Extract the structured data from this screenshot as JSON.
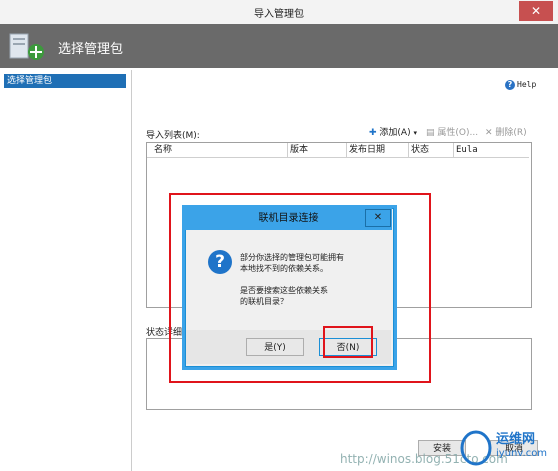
{
  "window": {
    "title": "导入管理包",
    "close_glyph": "✕"
  },
  "header": {
    "title": "选择管理包"
  },
  "sidebar": {
    "items": [
      {
        "label": "选择管理包"
      }
    ]
  },
  "help": {
    "label": "Help"
  },
  "import_list": {
    "label": "导入列表(M):",
    "toolbar": {
      "add": "添加(A)",
      "properties": "属性(O)...",
      "delete": "删除(R)"
    },
    "columns": [
      "名称",
      "版本",
      "发布日期",
      "状态",
      "Eula"
    ]
  },
  "status_details": {
    "label": "状态详细信息"
  },
  "dialog": {
    "title": "联机目录连接",
    "message_line1": "部分你选择的管理包可能拥有",
    "message_line2": "本地找不到的依赖关系。",
    "message_line3": "是否要搜索这些依赖关系",
    "message_line4": "的联机目录？",
    "yes_label": "是(Y)",
    "no_label": "否(N)",
    "close_glyph": "✕"
  },
  "footer": {
    "install_label": "安装",
    "cancel_label": "取消"
  },
  "watermark": {
    "url": "http://winos.blog.51cto.com",
    "site": "运维网",
    "site_sub": "iyunv.com"
  },
  "colors": {
    "accent": "#3ba3e8",
    "highlight": "#e0141b",
    "selection": "#1f6fb5"
  }
}
